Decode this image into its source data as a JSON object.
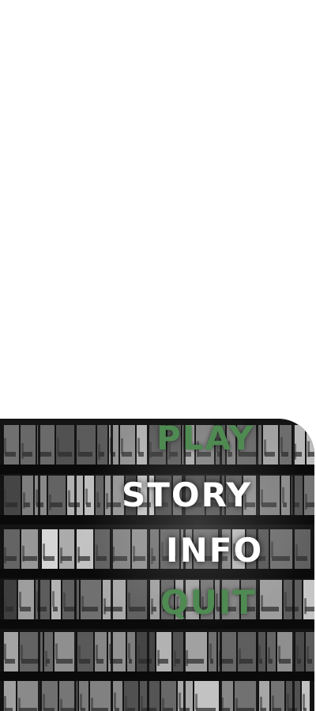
{
  "menu": {
    "items": [
      {
        "label": "PLAY",
        "color": "#4f8a52"
      },
      {
        "label": "STORY",
        "color": "#ffffff"
      },
      {
        "label": "INFO",
        "color": "#ffffff"
      },
      {
        "label": "QUIT",
        "color": "#4f8a52"
      }
    ]
  },
  "background": {
    "image": "office-building-at-night",
    "colors": {
      "dark": "#141414",
      "window_light": "#d9d9d9",
      "floor": "#0a0a0a"
    }
  }
}
